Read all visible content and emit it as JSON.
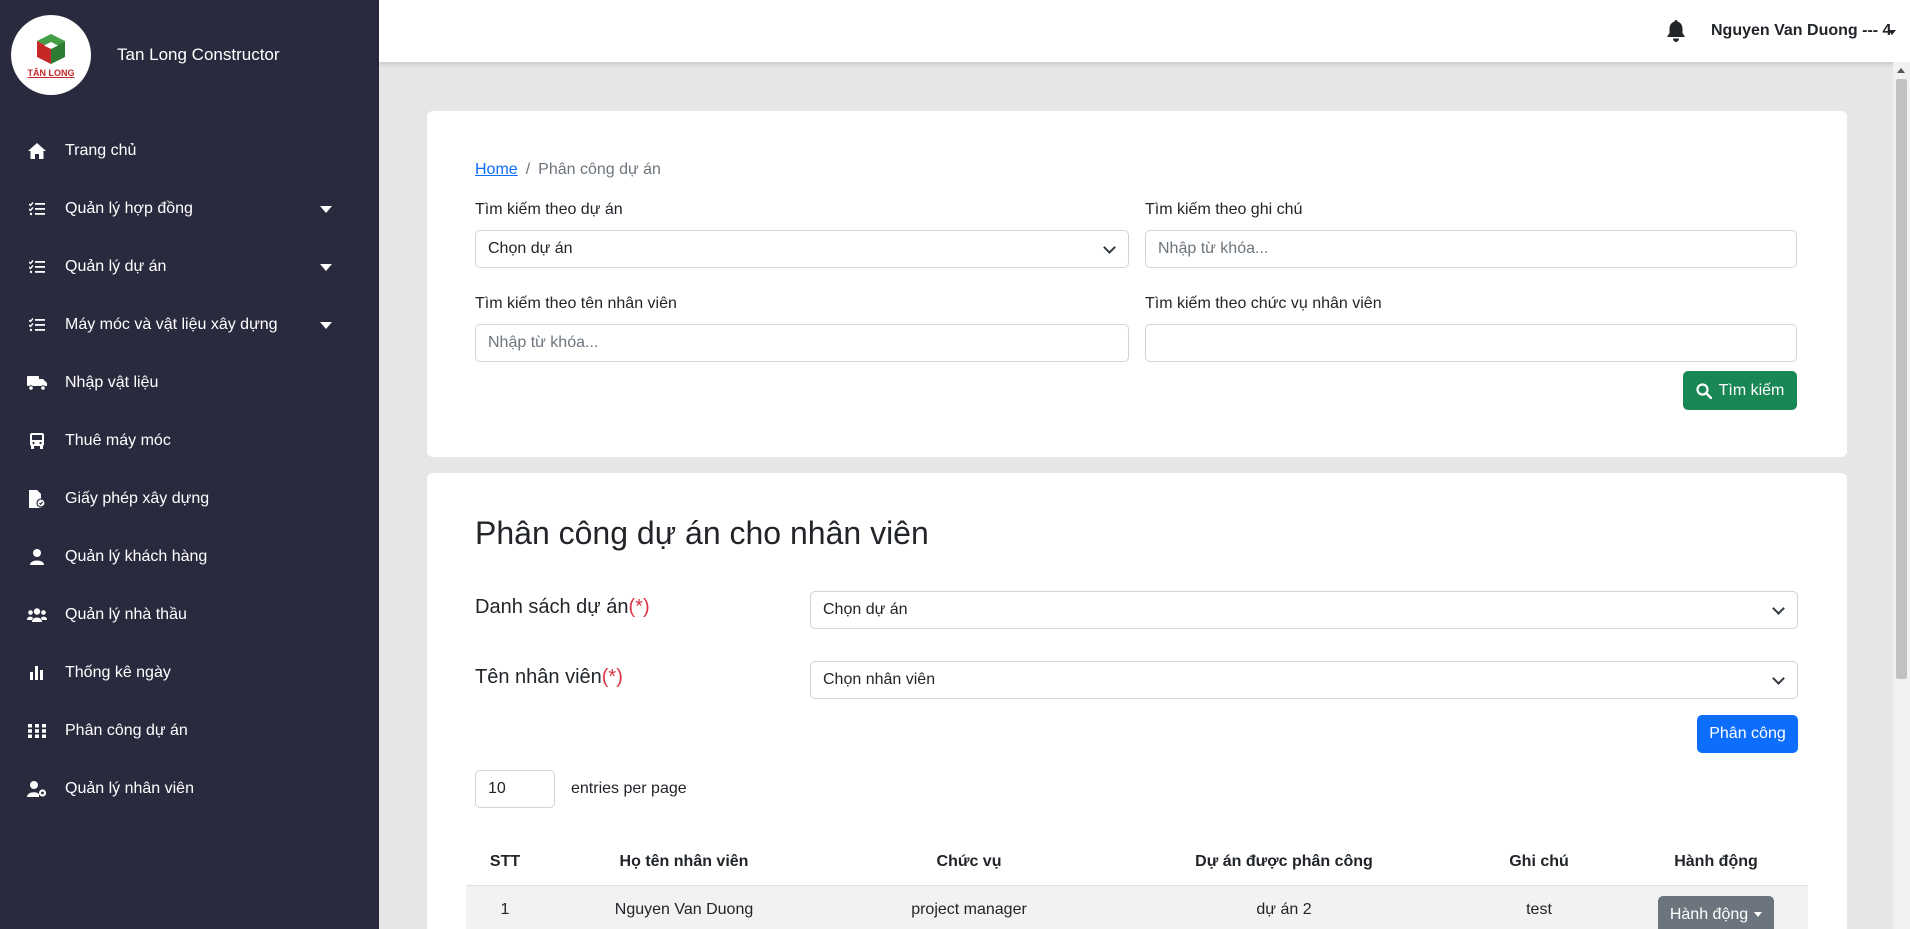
{
  "brand": {
    "name": "Tan Long Constructor",
    "logo_text": "TÂN LONG"
  },
  "sidebar": {
    "items": [
      {
        "label": "Trang chủ",
        "icon": "home-icon",
        "dropdown": false
      },
      {
        "label": "Quản lý hợp đồng",
        "icon": "list-check-icon",
        "dropdown": true
      },
      {
        "label": "Quản lý dự án",
        "icon": "list-check-icon",
        "dropdown": true
      },
      {
        "label": "Máy móc và vật liệu xây dựng",
        "icon": "list-check-icon",
        "dropdown": true
      },
      {
        "label": "Nhập vật liệu",
        "icon": "truck-icon",
        "dropdown": false
      },
      {
        "label": "Thuê máy móc",
        "icon": "bus-icon",
        "dropdown": false
      },
      {
        "label": "Giấy phép xây dựng",
        "icon": "file-permit-icon",
        "dropdown": false
      },
      {
        "label": "Quản lý khách hàng",
        "icon": "user-icon",
        "dropdown": false
      },
      {
        "label": "Quản lý nhà thầu",
        "icon": "users-icon",
        "dropdown": false
      },
      {
        "label": "Thống kê ngày",
        "icon": "chart-bar-icon",
        "dropdown": false
      },
      {
        "label": "Phân công dự án",
        "icon": "grid-icon",
        "dropdown": false
      },
      {
        "label": "Quản lý nhân viên",
        "icon": "user-gear-icon",
        "dropdown": false
      }
    ]
  },
  "topbar": {
    "user_name": "Nguyen Van Duong --- 4"
  },
  "breadcrumb": {
    "home": "Home",
    "current": "Phân công dự án"
  },
  "search": {
    "project_label": "Tìm kiếm theo dự án",
    "project_value": "Chọn dự án",
    "note_label": "Tìm kiếm theo ghi chú",
    "note_placeholder": "Nhập từ khóa...",
    "employee_label": "Tìm kiếm theo tên nhân viên",
    "employee_placeholder": "Nhập từ khóa...",
    "position_label": "Tìm kiếm theo chức vụ nhân viên",
    "position_value": "",
    "button": "Tìm kiếm"
  },
  "assign": {
    "title": "Phân công dự án cho nhân viên",
    "project_label": "Danh sách dự án",
    "employee_label": "Tên nhân viên",
    "required_mark": "(*)",
    "project_value": "Chọn dự án",
    "employee_value": "Chọn nhân viên",
    "button": "Phân công"
  },
  "entries": {
    "value": "10",
    "label": "entries per page"
  },
  "table": {
    "headers": [
      "STT",
      "Họ tên nhân viên",
      "Chức vụ",
      "Dự án được phân công",
      "Ghi chú",
      "Hành động"
    ],
    "rows": [
      {
        "stt": "1",
        "name": "Nguyen Van Duong",
        "position": "project manager",
        "project": "dự án 2",
        "note": "test",
        "action": "Hành động"
      }
    ]
  }
}
